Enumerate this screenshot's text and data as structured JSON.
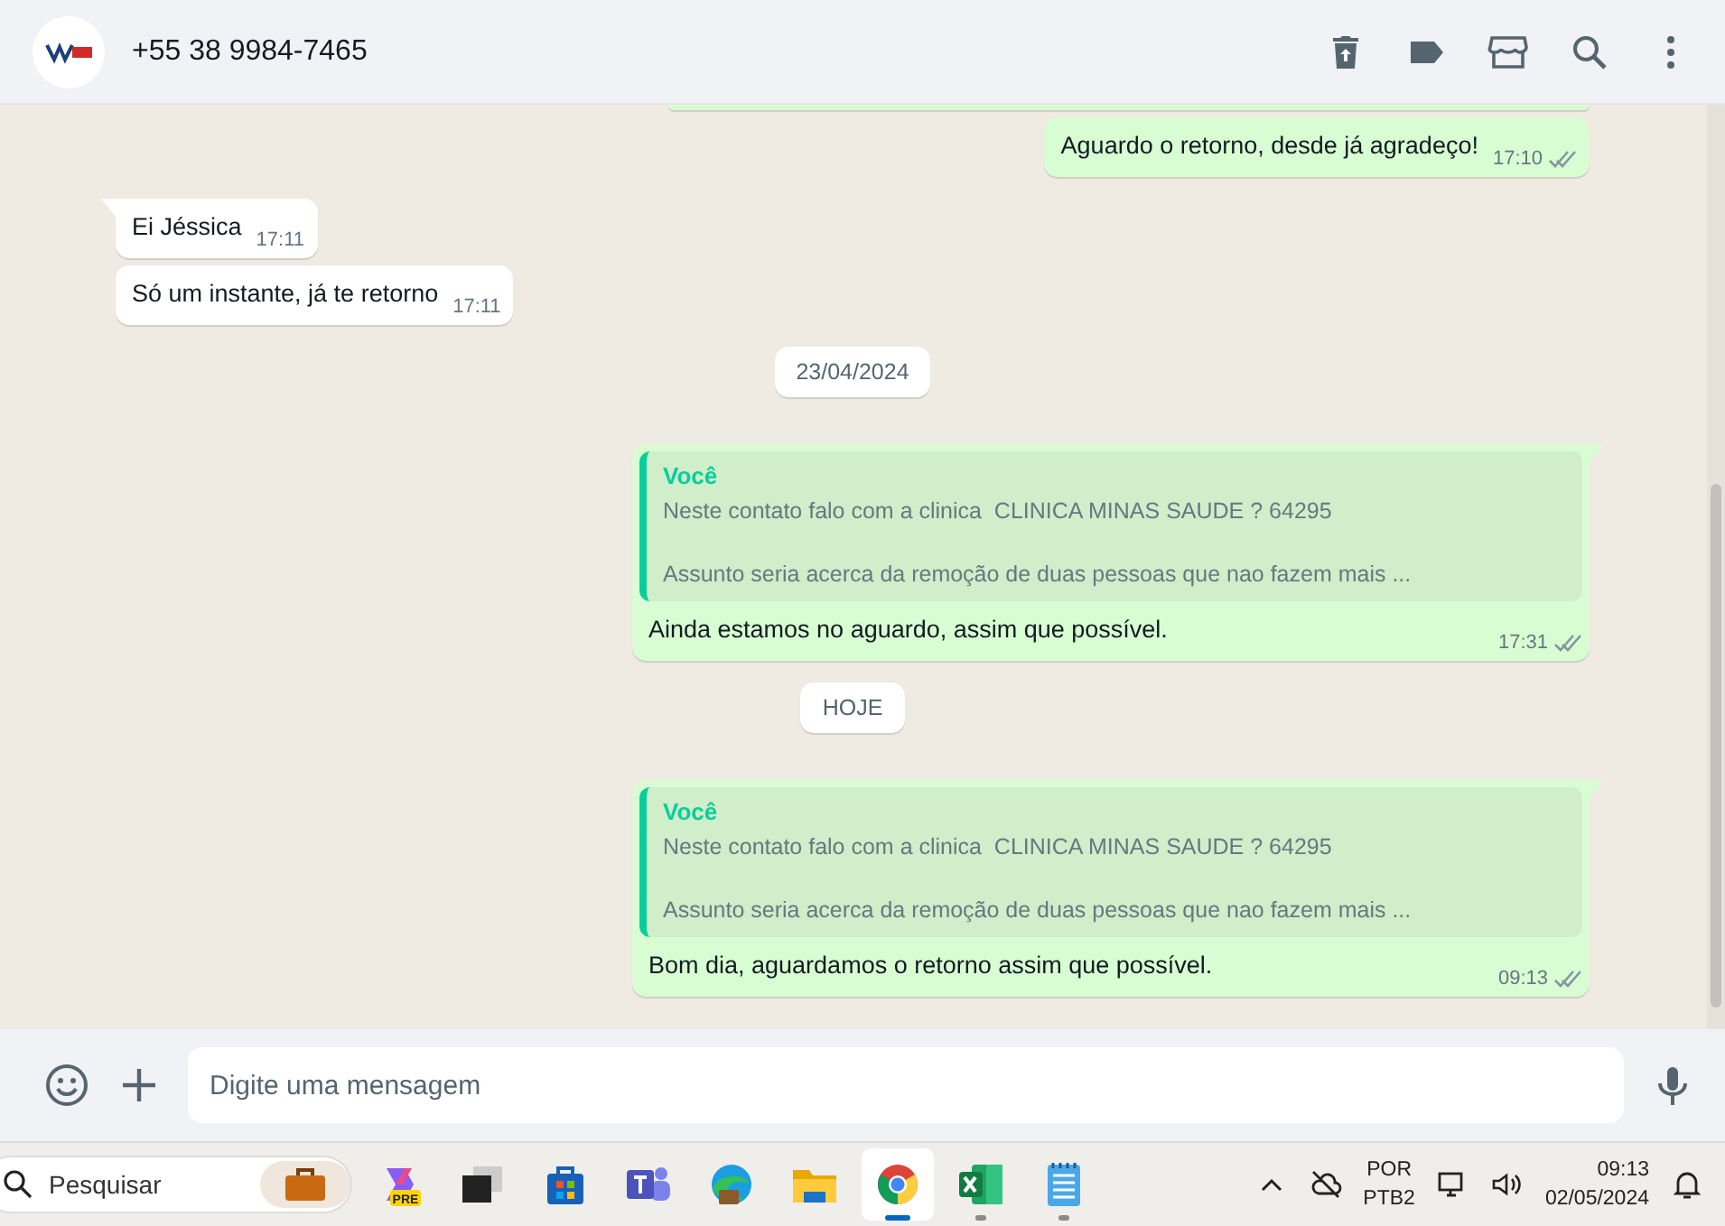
{
  "header": {
    "contact": "+55 38 9984-7465"
  },
  "messages": [
    {
      "kind": "edge"
    },
    {
      "kind": "out",
      "text": "Aguardo o retorno, desde já agradeço!",
      "time": "17:10",
      "read": false,
      "tail": false
    },
    {
      "kind": "in",
      "text": "Ei Jéssica",
      "time": "17:11",
      "tail": true
    },
    {
      "kind": "in",
      "text": "Só um instante, já te retorno",
      "time": "17:11",
      "tail": false
    },
    {
      "kind": "date",
      "text": "23/04/2024"
    },
    {
      "kind": "out",
      "quote": {
        "author": "Você",
        "lines": [
          "Neste contato falo com a clinica  CLINICA MINAS SAUDE ? 64295",
          "Assunto seria acerca da remoção de duas pessoas que nao fazem mais ..."
        ]
      },
      "text": "Ainda estamos no aguardo, assim que possível.",
      "time": "17:31",
      "read": false,
      "tail": true
    },
    {
      "kind": "date",
      "text": "HOJE"
    },
    {
      "kind": "out",
      "quote": {
        "author": "Você",
        "lines": [
          "Neste contato falo com a clinica  CLINICA MINAS SAUDE ? 64295",
          "Assunto seria acerca da remoção de duas pessoas que nao fazem mais ..."
        ]
      },
      "text": "Bom dia, aguardamos o retorno assim que possível.",
      "time": "09:13",
      "read": false,
      "tail": true
    }
  ],
  "composer": {
    "placeholder": "Digite uma mensagem"
  },
  "taskbar": {
    "search": "Pesquisar",
    "apps": [
      {
        "kind": "copilot",
        "running": false,
        "selected": false,
        "badge": "PRE"
      },
      {
        "kind": "taskview",
        "running": false,
        "selected": false
      },
      {
        "kind": "store",
        "running": false,
        "selected": false
      },
      {
        "kind": "teams",
        "running": false,
        "selected": false
      },
      {
        "kind": "edge",
        "running": false,
        "selected": false
      },
      {
        "kind": "folder",
        "running": false,
        "selected": false
      },
      {
        "kind": "chrome",
        "running": true,
        "selected": true
      },
      {
        "kind": "excel",
        "running": true,
        "selected": false
      },
      {
        "kind": "notepad",
        "running": true,
        "selected": false
      }
    ],
    "lang": "POR",
    "layout": "PTB2",
    "time": "09:13",
    "date": "02/05/2024"
  }
}
